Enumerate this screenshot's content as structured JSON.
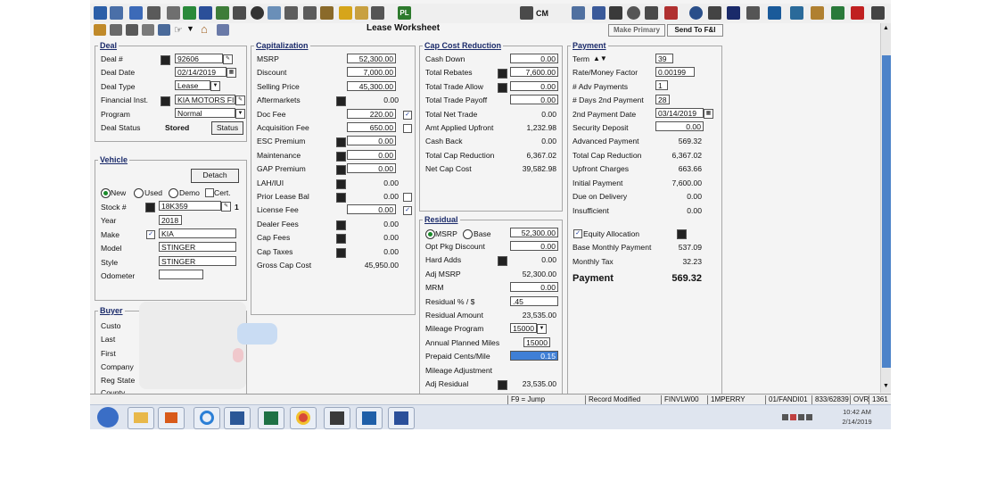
{
  "window": {
    "title": "Lease Worksheet"
  },
  "header_buttons": {
    "make_primary": "Make Primary",
    "send_to_fi": "Send To F&I"
  },
  "toolbar": {
    "pl_label": "PL",
    "cm_label": "CM"
  },
  "deal": {
    "legend": "Deal",
    "deal_num_label": "Deal #",
    "deal_num": "92606",
    "deal_date_label": "Deal Date",
    "deal_date": "02/14/2019",
    "deal_type_label": "Deal Type",
    "deal_type": "Lease",
    "financial_inst_label": "Financial Inst.",
    "financial_inst": "KIA MOTORS FI",
    "program_label": "Program",
    "program": "Normal",
    "deal_status_label": "Deal Status",
    "deal_status": "Stored",
    "status_button": "Status"
  },
  "vehicle": {
    "legend": "Vehicle",
    "detach_button": "Detach",
    "new_label": "New",
    "used_label": "Used",
    "demo_label": "Demo",
    "cert_label": "Cert.",
    "stock_label": "Stock #",
    "stock": "18K359",
    "stock_count": "1",
    "year_label": "Year",
    "year": "2018",
    "make_label": "Make",
    "make": "KIA",
    "model_label": "Model",
    "model": "STINGER",
    "style_label": "Style",
    "style": "STINGER",
    "odometer_label": "Odometer",
    "odometer": ""
  },
  "buyer": {
    "legend": "Buyer",
    "customer_label": "Custo",
    "last_label": "Last",
    "first_label": "First",
    "company_label": "Company",
    "reg_state_label": "Reg State",
    "county_label": "County"
  },
  "capitalization": {
    "legend": "Capitalization",
    "rows": [
      {
        "label": "MSRP",
        "value": "52,300.00"
      },
      {
        "label": "Discount",
        "value": "7,000.00"
      },
      {
        "label": "Selling Price",
        "value": "45,300.00"
      },
      {
        "label": "Aftermarkets",
        "value": "0.00"
      },
      {
        "label": "Doc Fee",
        "value": "220.00"
      },
      {
        "label": "Acquisition Fee",
        "value": "650.00"
      },
      {
        "label": "ESC Premium",
        "value": "0.00"
      },
      {
        "label": "Maintenance",
        "value": "0.00"
      },
      {
        "label": "GAP Premium",
        "value": "0.00"
      },
      {
        "label": "LAH/IUI",
        "value": "0.00"
      },
      {
        "label": "Prior Lease Bal",
        "value": "0.00"
      },
      {
        "label": "License Fee",
        "value": "0.00"
      },
      {
        "label": "Dealer Fees",
        "value": "0.00"
      },
      {
        "label": "Cap Fees",
        "value": "0.00"
      },
      {
        "label": "Cap Taxes",
        "value": "0.00"
      },
      {
        "label": "Gross Cap Cost",
        "value": "45,950.00"
      }
    ]
  },
  "cap_cost_reduction": {
    "legend": "Cap Cost Reduction",
    "rows": [
      {
        "label": "Cash Down",
        "value": "0.00"
      },
      {
        "label": "Total Rebates",
        "value": "7,600.00"
      },
      {
        "label": "Total Trade Allow",
        "value": "0.00"
      },
      {
        "label": "Total Trade Payoff",
        "value": "0.00"
      },
      {
        "label": "Total Net Trade",
        "value": "0.00"
      },
      {
        "label": "Amt Applied Upfront",
        "value": "1,232.98"
      },
      {
        "label": "Cash Back",
        "value": "0.00"
      },
      {
        "label": "Total Cap Reduction",
        "value": "6,367.02"
      },
      {
        "label": "Net Cap Cost",
        "value": "39,582.98"
      }
    ]
  },
  "residual": {
    "legend": "Residual",
    "msrp_label": "MSRP",
    "base_label": "Base",
    "msrp_value": "52,300.00",
    "rows": [
      {
        "label": "Opt Pkg Discount",
        "value": "0.00"
      },
      {
        "label": "Hard Adds",
        "value": "0.00"
      },
      {
        "label": "Adj MSRP",
        "value": "52,300.00"
      },
      {
        "label": "MRM",
        "value": "0.00"
      },
      {
        "label": "Residual % / $",
        "value": ".45"
      },
      {
        "label": "Residual Amount",
        "value": "23,535.00"
      },
      {
        "label": "Mileage Program",
        "value": "15000"
      },
      {
        "label": "Annual Planned Miles",
        "value": "15000"
      },
      {
        "label": "Prepaid Cents/Mile",
        "value": "0.15"
      },
      {
        "label": "Mileage Adjustment",
        "value": ""
      },
      {
        "label": "Adj Residual",
        "value": "23,535.00"
      }
    ]
  },
  "payment": {
    "legend": "Payment",
    "term_label": "Term",
    "term": "39",
    "rate_label": "Rate/Money Factor",
    "rate": "0.00199",
    "adv_payments_label": "# Adv Payments",
    "adv_payments": "1",
    "days_label": "# Days 2nd Payment",
    "days": "28",
    "second_date_label": "2nd Payment Date",
    "second_date": "03/14/2019",
    "security_label": "Security Deposit",
    "security": "0.00",
    "advanced_label": "Advanced Payment",
    "advanced": "569.32",
    "total_cap_label": "Total Cap Reduction",
    "total_cap": "6,367.02",
    "upfront_label": "Upfront Charges",
    "upfront": "663.66",
    "initial_label": "Initial Payment",
    "initial": "7,600.00",
    "due_label": "Due on Delivery",
    "due": "0.00",
    "insufficient_label": "Insufficient",
    "insufficient": "0.00",
    "equity_label": "Equity Allocation",
    "base_monthly_label": "Base Monthly Payment",
    "base_monthly": "537.09",
    "monthly_tax_label": "Monthly Tax",
    "monthly_tax": "32.23",
    "payment_label": "Payment",
    "payment": "569.32"
  },
  "statusbar": {
    "f9": "F9 = Jump",
    "record": "Record Modified",
    "finv": "FINVLW00",
    "user": "1MPERRY",
    "code1": "01/FANDI01",
    "code2": "833/62839",
    "ovr": "OVR",
    "num": "1361"
  },
  "taskbar": {
    "time": "10:42 AM",
    "date": "2/14/2019"
  },
  "colors": {
    "accent": "#4d83c9",
    "legend": "#1a2a6a",
    "highlight": "#3f7fd6"
  }
}
